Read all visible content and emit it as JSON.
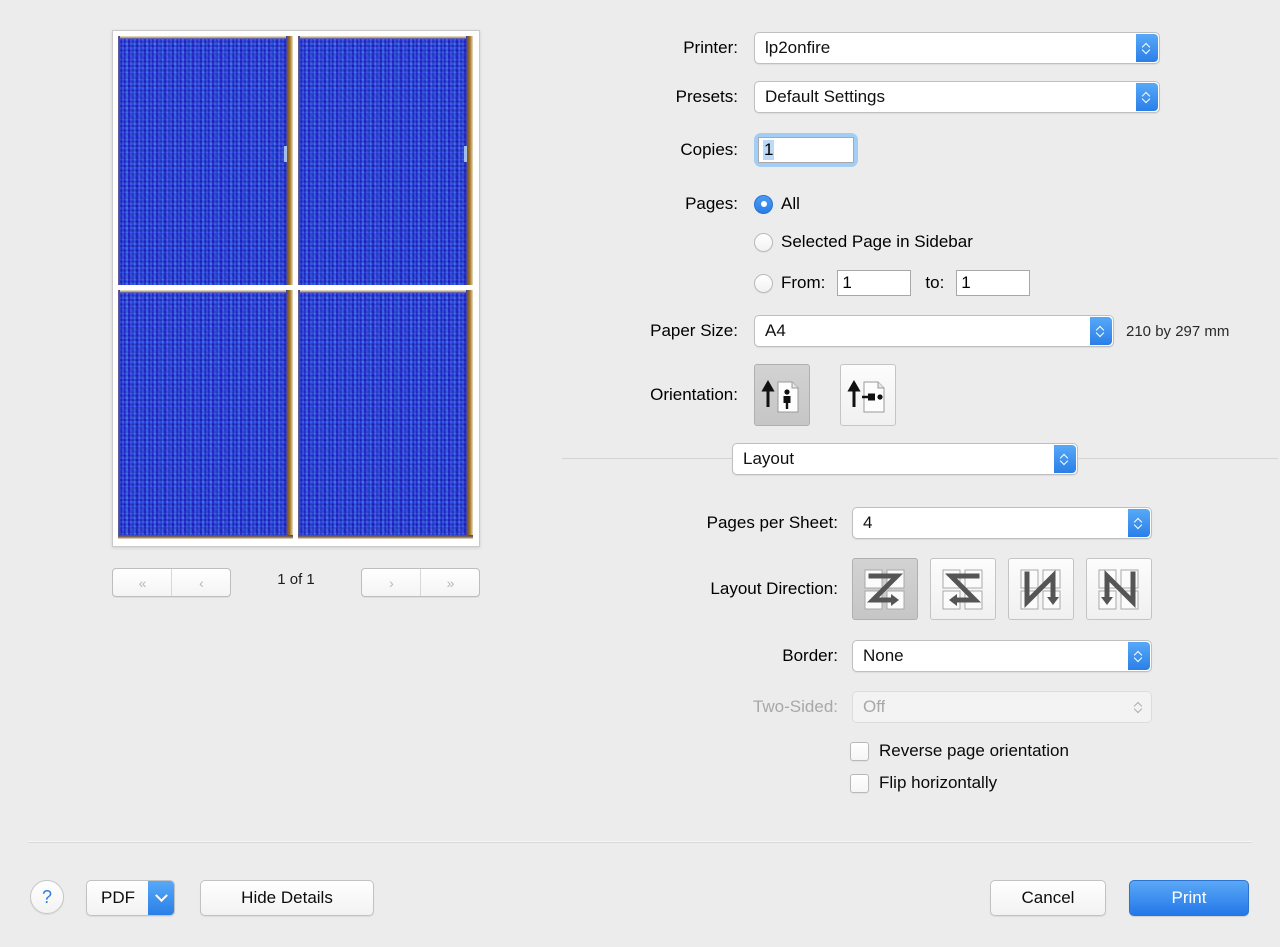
{
  "preview": {
    "pager": {
      "first_label": "«",
      "prev_label": "‹",
      "next_label": "›",
      "last_label": "»",
      "count_label": "1 of 1"
    },
    "pages_shown": 4
  },
  "settings": {
    "printer": {
      "label": "Printer:",
      "value": "lp2onfire"
    },
    "presets": {
      "label": "Presets:",
      "value": "Default Settings"
    },
    "copies": {
      "label": "Copies:",
      "value": "1"
    },
    "pages": {
      "label": "Pages:",
      "options": [
        {
          "label": "All",
          "selected": true
        },
        {
          "label": "Selected Page in Sidebar",
          "selected": false
        },
        {
          "label": "From:",
          "selected": false
        }
      ],
      "from_value": "1",
      "to_label": "to:",
      "to_value": "1"
    },
    "paper_size": {
      "label": "Paper Size:",
      "value": "A4",
      "note": "210 by 297 mm"
    },
    "orientation": {
      "label": "Orientation:",
      "options": [
        {
          "name": "portrait",
          "selected": true
        },
        {
          "name": "landscape",
          "selected": false
        }
      ]
    },
    "pane_selector": {
      "value": "Layout"
    },
    "pages_per_sheet": {
      "label": "Pages per Sheet:",
      "value": "4"
    },
    "layout_direction": {
      "label": "Layout Direction:",
      "options": [
        {
          "name": "z-right-then-down",
          "selected": true
        },
        {
          "name": "z-left-then-down",
          "selected": false
        },
        {
          "name": "n-down-then-right",
          "selected": false
        },
        {
          "name": "n-down-then-left",
          "selected": false
        }
      ]
    },
    "border": {
      "label": "Border:",
      "value": "None"
    },
    "two_sided": {
      "label": "Two-Sided:",
      "value": "Off",
      "disabled": true
    },
    "checkboxes": [
      {
        "label": "Reverse page orientation",
        "checked": false
      },
      {
        "label": "Flip horizontally",
        "checked": false
      }
    ]
  },
  "footer": {
    "help_label": "?",
    "pdf_label": "PDF",
    "hide_details_label": "Hide Details",
    "cancel_label": "Cancel",
    "print_label": "Print"
  },
  "colors": {
    "accent": "#2a7fe8",
    "window_bg": "#ececec",
    "preview_page": "#2b3ee8"
  }
}
